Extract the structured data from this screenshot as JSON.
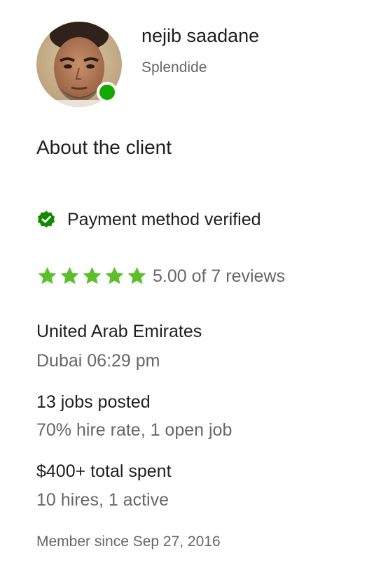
{
  "client": {
    "name": "nejib saadane",
    "company": "Splendide",
    "online_status_color": "#14a800",
    "avatar_icon": "user-photo"
  },
  "about": {
    "title": "About the client"
  },
  "payment": {
    "label": "Payment method verified",
    "icon": "verified-check-icon",
    "icon_color": "#108a00"
  },
  "rating": {
    "stars": 5,
    "max_stars": 5,
    "text": "5.00 of 7 reviews",
    "star_color": "#5bbf2c"
  },
  "location": {
    "country": "United Arab Emirates",
    "city_time": "Dubai 06:29 pm"
  },
  "jobs": {
    "posted": "13 jobs posted",
    "detail": "70% hire rate, 1 open job"
  },
  "spent": {
    "total": "$400+ total spent",
    "detail": "10 hires, 1 active"
  },
  "member": {
    "since": "Member since Sep 27, 2016"
  }
}
